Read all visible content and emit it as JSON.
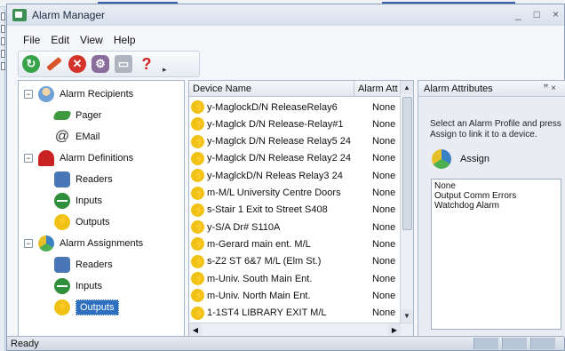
{
  "window": {
    "title": "Alarm Manager",
    "controls": [
      "_",
      "□",
      "×"
    ]
  },
  "menu": {
    "items": [
      "File",
      "Edit",
      "View",
      "Help"
    ]
  },
  "toolbar": {
    "buttons": [
      {
        "icon": "refresh-icon"
      },
      {
        "icon": "edit-icon"
      },
      {
        "icon": "delete-icon"
      },
      {
        "icon": "settings-icon"
      },
      {
        "icon": "print-icon"
      },
      {
        "icon": "help-icon"
      }
    ],
    "overflow": "▸"
  },
  "tree": {
    "recipients": {
      "label": "Alarm Recipients",
      "expander": "−",
      "children": [
        {
          "label": "Pager"
        },
        {
          "label": "EMail"
        }
      ]
    },
    "definitions": {
      "label": "Alarm Definitions",
      "expander": "−",
      "children": [
        {
          "label": "Readers"
        },
        {
          "label": "Inputs"
        },
        {
          "label": "Outputs"
        }
      ]
    },
    "assignments": {
      "label": "Alarm Assignments",
      "expander": "−",
      "children": [
        {
          "label": "Readers"
        },
        {
          "label": "Inputs"
        },
        {
          "label": "Outputs",
          "selected": true
        }
      ]
    }
  },
  "list": {
    "columns": [
      "Device Name",
      "Alarm Att"
    ],
    "rows": [
      {
        "name": "y-MaglockD/N ReleaseRelay6",
        "attr": "None"
      },
      {
        "name": "y-Maglck D/N Release-Relay#1",
        "attr": "None"
      },
      {
        "name": "y-Maglck D/N Release Relay5 24",
        "attr": "None"
      },
      {
        "name": "y-Maglck D/N Release Relay2 24",
        "attr": "None"
      },
      {
        "name": "y-MaglckD/N Releas Relay3 24",
        "attr": "None"
      },
      {
        "name": "m-M/L University Centre Doors",
        "attr": "None"
      },
      {
        "name": "s-Stair 1 Exit to Street S408",
        "attr": "None"
      },
      {
        "name": "y-S/A Dr# S110A",
        "attr": "None"
      },
      {
        "name": "m-Gerard main ent. M/L",
        "attr": "None"
      },
      {
        "name": "s-Z2 ST 6&7 M/L (Elm St.)",
        "attr": "None"
      },
      {
        "name": "m-Univ. South Main Ent.",
        "attr": "None"
      },
      {
        "name": "m-Univ. North Main Ent.",
        "attr": "None"
      },
      {
        "name": "1-1ST4 LIBRARY EXIT M/L",
        "attr": "None"
      }
    ]
  },
  "attributes_panel": {
    "title": "Alarm Attributes",
    "pin": "ꟸ ×",
    "instruction": "Select an Alarm Profile and press Assign to link it to a device.",
    "assign_label": "Assign",
    "profiles": [
      "None",
      "Output Comm Errors",
      "Watchdog Alarm"
    ]
  },
  "status": {
    "text": "Ready"
  }
}
